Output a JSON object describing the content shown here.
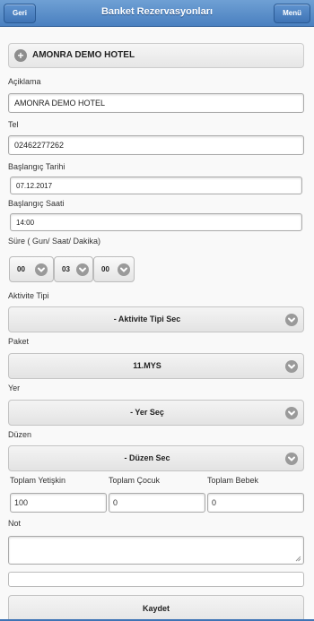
{
  "header": {
    "title": "Banket Rezervasyonları",
    "back_label": "Geri",
    "menu_label": "Menü"
  },
  "hotel": {
    "name": "AMONRA DEMO HOTEL"
  },
  "form": {
    "aciklama_label": "Açiklama",
    "aciklama_value": "AMONRA DEMO HOTEL",
    "tel_label": "Tel",
    "tel_value": "02462277262",
    "baslangic_tarihi_label": "Başlangıç Tarihi",
    "baslangic_tarihi_value": "07.12.2017",
    "baslangic_saati_label": "Başlangıç Saati",
    "baslangic_saati_value": "14:00",
    "sure_label": "Süre ( Gun/ Saat/ Dakika)",
    "sure_gun": "00",
    "sure_saat": "03",
    "sure_dakika": "00",
    "aktivite_label": "Aktivite Tipi",
    "aktivite_value": "- Aktivite Tipi Sec",
    "paket_label": "Paket",
    "paket_value": "11.MYS",
    "yer_label": "Yer",
    "yer_value": "- Yer Seç",
    "duzen_label": "Düzen",
    "duzen_value": "- Düzen Sec",
    "yetiskin_label": "Toplam Yetişkin",
    "yetiskin_value": "100",
    "cocuk_label": "Toplam Çocuk",
    "cocuk_value": "0",
    "bebek_label": "Toplam Bebek",
    "bebek_value": "0",
    "not_label": "Not",
    "not_value": "",
    "save_label": "Kaydet"
  },
  "colors": {
    "header": "#4a80c0",
    "accent": "#3f74b5"
  }
}
